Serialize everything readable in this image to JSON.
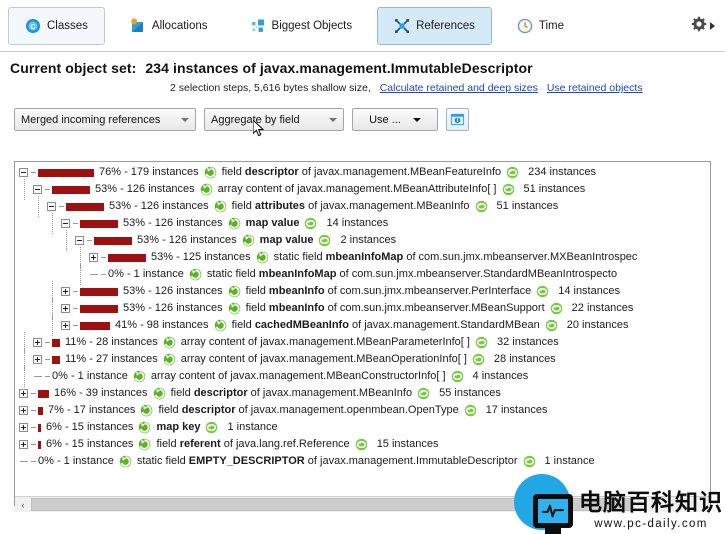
{
  "tabs": [
    {
      "label": "Classes",
      "icon": "classes-icon",
      "state": "framed"
    },
    {
      "label": "Allocations",
      "icon": "allocations-icon",
      "state": "plain"
    },
    {
      "label": "Biggest Objects",
      "icon": "biggest-objects-icon",
      "state": "plain"
    },
    {
      "label": "References",
      "icon": "references-icon",
      "state": "active"
    },
    {
      "label": "Time",
      "icon": "time-icon",
      "state": "plain"
    }
  ],
  "tab_overflow": {
    "icon": "gear-icon",
    "arrow": "chevron-right-icon"
  },
  "header": {
    "label": "Current object set:",
    "title": "234 instances of javax.management.ImmutableDescriptor",
    "subtitle": "2 selection steps, 5,616 bytes shallow size,",
    "link_calculate": "Calculate retained and deep sizes",
    "link_use_retained": "Use retained objects"
  },
  "toolbar": {
    "view_mode": "Merged incoming references",
    "aggregation": "Aggregate by field",
    "use_menu": "Use ...",
    "info_button_icon": "info-icon"
  },
  "colors": {
    "bar": "#9e1111",
    "accent": "#22a7e5",
    "tab_active_bg": "#d6e9f6",
    "link": "#1b49b5",
    "ref_icon": "#5db423",
    "count_icon": "#7ac943"
  },
  "tree": {
    "rows": [
      {
        "depth": 0,
        "toggle": "minus",
        "bar": 56,
        "pct": "76% - 179 instances",
        "icon": "reference-icon",
        "pre": "field ",
        "bold": "descriptor",
        "post": " of javax.management.MBeanFeatureInfo",
        "count": "234 instances"
      },
      {
        "depth": 1,
        "toggle": "minus",
        "bar": 38,
        "pct": "53% - 126 instances",
        "icon": "reference-icon",
        "pre": "array content of javax.management.MBeanAttributeInfo[ ]",
        "bold": "",
        "post": "",
        "count": "51 instances"
      },
      {
        "depth": 2,
        "toggle": "minus",
        "bar": 38,
        "pct": "53% - 126 instances",
        "icon": "reference-icon",
        "pre": "field ",
        "bold": "attributes",
        "post": " of javax.management.MBeanInfo",
        "count": "51 instances"
      },
      {
        "depth": 3,
        "toggle": "minus",
        "bar": 38,
        "pct": "53% - 126 instances",
        "icon": "reference-icon",
        "pre": "",
        "bold": "map value",
        "post": "",
        "count": "14 instances"
      },
      {
        "depth": 4,
        "toggle": "minus",
        "bar": 38,
        "pct": "53% - 126 instances",
        "icon": "reference-icon",
        "pre": "",
        "bold": "map value",
        "post": "",
        "count": "2 instances"
      },
      {
        "depth": 5,
        "toggle": "plus",
        "bar": 38,
        "pct": "53% - 125 instances",
        "icon": "reference-icon",
        "pre": "static field ",
        "bold": "mbeanInfoMap",
        "post": " of com.sun.jmx.mbeanserver.MXBeanIntrospec",
        "count": ""
      },
      {
        "depth": 5,
        "toggle": "none",
        "bar": 0,
        "pct": "0% - 1 instance",
        "icon": "reference-icon",
        "pre": "static field ",
        "bold": "mbeanInfoMap",
        "post": " of com.sun.jmx.mbeanserver.StandardMBeanIntrospecto",
        "count": ""
      },
      {
        "depth": 3,
        "toggle": "plus",
        "bar": 38,
        "pct": "53% - 126 instances",
        "icon": "reference-icon",
        "pre": "field ",
        "bold": "mbeanInfo",
        "post": " of com.sun.jmx.mbeanserver.PerInterface",
        "count": "14 instances"
      },
      {
        "depth": 3,
        "toggle": "plus",
        "bar": 38,
        "pct": "53% - 126 instances",
        "icon": "reference-icon",
        "pre": "field ",
        "bold": "mbeanInfo",
        "post": " of com.sun.jmx.mbeanserver.MBeanSupport",
        "count": "22 instances"
      },
      {
        "depth": 3,
        "toggle": "plus",
        "bar": 30,
        "pct": "41% - 98 instances",
        "icon": "reference-icon",
        "pre": "field ",
        "bold": "cachedMBeanInfo",
        "post": " of javax.management.StandardMBean",
        "count": "20 instances"
      },
      {
        "depth": 1,
        "toggle": "plus",
        "bar": 8,
        "pct": "11% - 28 instances",
        "icon": "reference-icon",
        "pre": "array content of javax.management.MBeanParameterInfo[ ]",
        "bold": "",
        "post": "",
        "count": "32 instances"
      },
      {
        "depth": 1,
        "toggle": "plus",
        "bar": 8,
        "pct": "11% - 27 instances",
        "icon": "reference-icon",
        "pre": "array content of javax.management.MBeanOperationInfo[ ]",
        "bold": "",
        "post": "",
        "count": "28 instances"
      },
      {
        "depth": 1,
        "toggle": "none",
        "bar": 0,
        "pct": "0% - 1 instance",
        "icon": "reference-icon",
        "pre": "array content of javax.management.MBeanConstructorInfo[ ]",
        "bold": "",
        "post": "",
        "count": "4 instances"
      },
      {
        "depth": 0,
        "toggle": "plus",
        "bar": 11,
        "pct": "16% - 39 instances",
        "icon": "reference-icon",
        "pre": "field ",
        "bold": "descriptor",
        "post": " of javax.management.MBeanInfo",
        "count": "55 instances"
      },
      {
        "depth": 0,
        "toggle": "plus",
        "bar": 5,
        "pct": "7% - 17 instances",
        "icon": "reference-icon",
        "pre": "field ",
        "bold": "descriptor",
        "post": " of javax.management.openmbean.OpenType",
        "count": "17 instances"
      },
      {
        "depth": 0,
        "toggle": "plus",
        "bar": 3,
        "pct": "6% - 15 instances",
        "icon": "reference-icon",
        "pre": "",
        "bold": "map key",
        "post": "",
        "count": "1 instance"
      },
      {
        "depth": 0,
        "toggle": "plus",
        "bar": 3,
        "pct": "6% - 15 instances",
        "icon": "reference-icon",
        "pre": "field ",
        "bold": "referent",
        "post": " of java.lang.ref.Reference",
        "count": "15 instances"
      },
      {
        "depth": 0,
        "toggle": "none",
        "bar": 0,
        "pct": "0% - 1 instance",
        "icon": "reference-icon",
        "pre": "static field ",
        "bold": "EMPTY_DESCRIPTOR",
        "post": " of javax.management.ImmutableDescriptor",
        "count": "1 instance"
      }
    ]
  },
  "scrollbar": {
    "left_arrow": "‹",
    "right_arrow": "›"
  },
  "watermark": {
    "cn": "电脑百科知识",
    "url": "www.pc-daily.com",
    "icon": "monitor-pulse-icon"
  }
}
